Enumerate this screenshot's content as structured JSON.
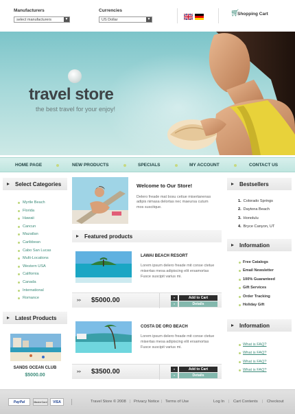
{
  "topbar": {
    "manufacturers_label": "Manufacturers",
    "manufacturers_value": "select manufacturers",
    "currencies_label": "Currencies",
    "currencies_value": "US Dollar",
    "cart_label": "Shopping Cart"
  },
  "banner": {
    "title": "travel store",
    "tagline": "the best travel for your enjoy!"
  },
  "nav": [
    "HOME PAGE",
    "NEW PRODUCTS",
    "SPECIALS",
    "MY ACCOUNT",
    "CONTACT US"
  ],
  "categories": {
    "heading": "Select Categories",
    "items": [
      "Myrtle Beach",
      "Florida",
      "Hawaii",
      "Cancun",
      "Mazatlan",
      "Caribbean",
      "Cabo San Lucas",
      "Multi-Locations",
      "Western USA",
      "California",
      "Canada",
      "International",
      "Romance"
    ]
  },
  "latest": {
    "heading": "Latest Products",
    "name": "SANDS OCEAN CLUB",
    "price": "$5000.00"
  },
  "welcome": {
    "title": "Welcome to Our Store!",
    "text": "Delero freade mat bosu cetiue misertanenas adipis nimasa delortas nec maeursa cutum mos suscitque."
  },
  "featured": {
    "heading": "Featured products",
    "products": [
      {
        "name": "LAWAI BEACH RESORT",
        "desc": "Lorem ipsum delero freade mit conse ctetue misertas mesa adipiscing elit ersamortas Fusce suscipit varius mi.",
        "price": "$5000.00",
        "add": "Add to Cart",
        "details": "Details"
      },
      {
        "name": "COSTA DE ORO BEACH",
        "desc": "Lorem ipsum delero freade mit conse ctetue misertas mesa adipiscing elit ersamortas Fusce suscipit varius mi.",
        "price": "$3500.00",
        "add": "Add to Cart",
        "details": "Details"
      }
    ]
  },
  "bestsellers": {
    "heading": "Bestsellers",
    "items": [
      "Colorado Springs",
      "Daytona Beach",
      "Honolulu",
      "Bryce Canyon, UT"
    ]
  },
  "information1": {
    "heading": "Information",
    "items": [
      "Free Catalogs",
      "Email Newsletter",
      "100% Guaranteed",
      "Gift Services",
      "Order Tracking",
      "Holiday Gift"
    ]
  },
  "information2": {
    "heading": "Information",
    "items": [
      "What is FAQ?",
      "What is FAQ?",
      "What is FAQ?",
      "What is FAQ?"
    ]
  },
  "footer": {
    "payments": [
      "PayPal",
      "MasterCard",
      "VISA"
    ],
    "copyright": "Travel Store © 2008",
    "privacy": "Privacy Notice",
    "terms": "Terms of Use",
    "login": "Log In",
    "cart_contents": "Cart Contents",
    "checkout": "Checkout"
  },
  "colors": {
    "accent": "#3a8a78",
    "nav_bg": "#c8ebe5",
    "bullet": "#bcd67a"
  }
}
